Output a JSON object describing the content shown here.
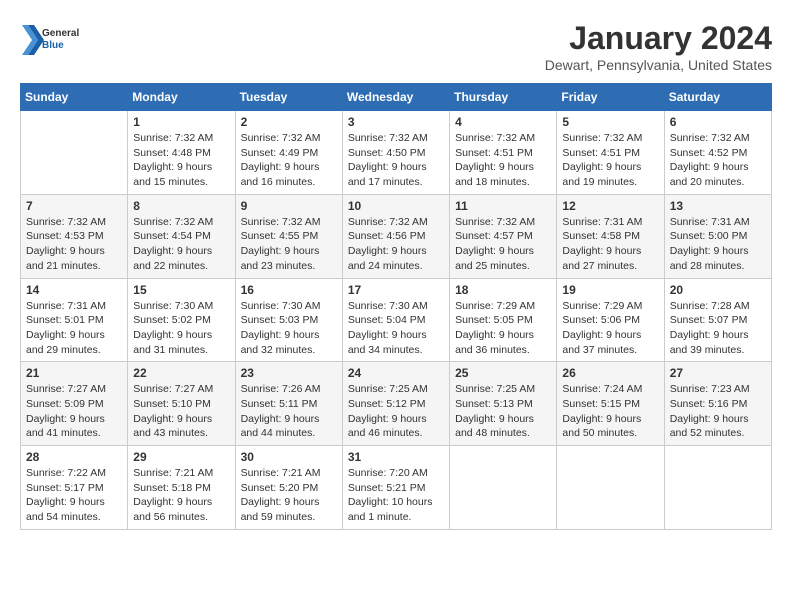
{
  "header": {
    "logo_general": "General",
    "logo_blue": "Blue",
    "month_title": "January 2024",
    "location": "Dewart, Pennsylvania, United States"
  },
  "weekdays": [
    "Sunday",
    "Monday",
    "Tuesday",
    "Wednesday",
    "Thursday",
    "Friday",
    "Saturday"
  ],
  "weeks": [
    [
      {
        "day": "",
        "info": ""
      },
      {
        "day": "1",
        "info": "Sunrise: 7:32 AM\nSunset: 4:48 PM\nDaylight: 9 hours\nand 15 minutes."
      },
      {
        "day": "2",
        "info": "Sunrise: 7:32 AM\nSunset: 4:49 PM\nDaylight: 9 hours\nand 16 minutes."
      },
      {
        "day": "3",
        "info": "Sunrise: 7:32 AM\nSunset: 4:50 PM\nDaylight: 9 hours\nand 17 minutes."
      },
      {
        "day": "4",
        "info": "Sunrise: 7:32 AM\nSunset: 4:51 PM\nDaylight: 9 hours\nand 18 minutes."
      },
      {
        "day": "5",
        "info": "Sunrise: 7:32 AM\nSunset: 4:51 PM\nDaylight: 9 hours\nand 19 minutes."
      },
      {
        "day": "6",
        "info": "Sunrise: 7:32 AM\nSunset: 4:52 PM\nDaylight: 9 hours\nand 20 minutes."
      }
    ],
    [
      {
        "day": "7",
        "info": "Sunrise: 7:32 AM\nSunset: 4:53 PM\nDaylight: 9 hours\nand 21 minutes."
      },
      {
        "day": "8",
        "info": "Sunrise: 7:32 AM\nSunset: 4:54 PM\nDaylight: 9 hours\nand 22 minutes."
      },
      {
        "day": "9",
        "info": "Sunrise: 7:32 AM\nSunset: 4:55 PM\nDaylight: 9 hours\nand 23 minutes."
      },
      {
        "day": "10",
        "info": "Sunrise: 7:32 AM\nSunset: 4:56 PM\nDaylight: 9 hours\nand 24 minutes."
      },
      {
        "day": "11",
        "info": "Sunrise: 7:32 AM\nSunset: 4:57 PM\nDaylight: 9 hours\nand 25 minutes."
      },
      {
        "day": "12",
        "info": "Sunrise: 7:31 AM\nSunset: 4:58 PM\nDaylight: 9 hours\nand 27 minutes."
      },
      {
        "day": "13",
        "info": "Sunrise: 7:31 AM\nSunset: 5:00 PM\nDaylight: 9 hours\nand 28 minutes."
      }
    ],
    [
      {
        "day": "14",
        "info": "Sunrise: 7:31 AM\nSunset: 5:01 PM\nDaylight: 9 hours\nand 29 minutes."
      },
      {
        "day": "15",
        "info": "Sunrise: 7:30 AM\nSunset: 5:02 PM\nDaylight: 9 hours\nand 31 minutes."
      },
      {
        "day": "16",
        "info": "Sunrise: 7:30 AM\nSunset: 5:03 PM\nDaylight: 9 hours\nand 32 minutes."
      },
      {
        "day": "17",
        "info": "Sunrise: 7:30 AM\nSunset: 5:04 PM\nDaylight: 9 hours\nand 34 minutes."
      },
      {
        "day": "18",
        "info": "Sunrise: 7:29 AM\nSunset: 5:05 PM\nDaylight: 9 hours\nand 36 minutes."
      },
      {
        "day": "19",
        "info": "Sunrise: 7:29 AM\nSunset: 5:06 PM\nDaylight: 9 hours\nand 37 minutes."
      },
      {
        "day": "20",
        "info": "Sunrise: 7:28 AM\nSunset: 5:07 PM\nDaylight: 9 hours\nand 39 minutes."
      }
    ],
    [
      {
        "day": "21",
        "info": "Sunrise: 7:27 AM\nSunset: 5:09 PM\nDaylight: 9 hours\nand 41 minutes."
      },
      {
        "day": "22",
        "info": "Sunrise: 7:27 AM\nSunset: 5:10 PM\nDaylight: 9 hours\nand 43 minutes."
      },
      {
        "day": "23",
        "info": "Sunrise: 7:26 AM\nSunset: 5:11 PM\nDaylight: 9 hours\nand 44 minutes."
      },
      {
        "day": "24",
        "info": "Sunrise: 7:25 AM\nSunset: 5:12 PM\nDaylight: 9 hours\nand 46 minutes."
      },
      {
        "day": "25",
        "info": "Sunrise: 7:25 AM\nSunset: 5:13 PM\nDaylight: 9 hours\nand 48 minutes."
      },
      {
        "day": "26",
        "info": "Sunrise: 7:24 AM\nSunset: 5:15 PM\nDaylight: 9 hours\nand 50 minutes."
      },
      {
        "day": "27",
        "info": "Sunrise: 7:23 AM\nSunset: 5:16 PM\nDaylight: 9 hours\nand 52 minutes."
      }
    ],
    [
      {
        "day": "28",
        "info": "Sunrise: 7:22 AM\nSunset: 5:17 PM\nDaylight: 9 hours\nand 54 minutes."
      },
      {
        "day": "29",
        "info": "Sunrise: 7:21 AM\nSunset: 5:18 PM\nDaylight: 9 hours\nand 56 minutes."
      },
      {
        "day": "30",
        "info": "Sunrise: 7:21 AM\nSunset: 5:20 PM\nDaylight: 9 hours\nand 59 minutes."
      },
      {
        "day": "31",
        "info": "Sunrise: 7:20 AM\nSunset: 5:21 PM\nDaylight: 10 hours\nand 1 minute."
      },
      {
        "day": "",
        "info": ""
      },
      {
        "day": "",
        "info": ""
      },
      {
        "day": "",
        "info": ""
      }
    ]
  ]
}
